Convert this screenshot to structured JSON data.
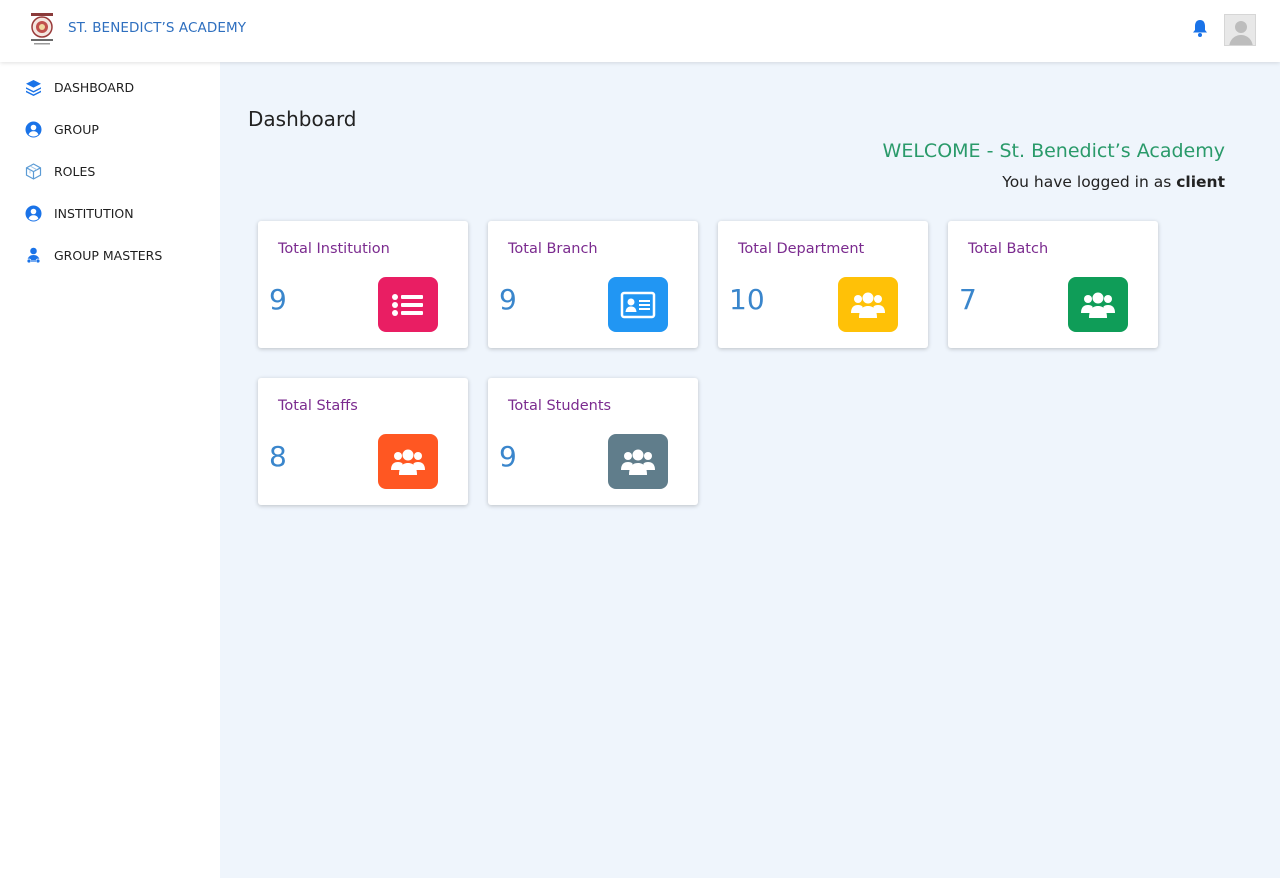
{
  "header": {
    "brand": "ST. BENEDICT’S ACADEMY",
    "logo_icon": "school-crest-icon",
    "notification_icon": "bell-icon",
    "avatar_icon": "user-avatar-icon"
  },
  "sidebar": {
    "items": [
      {
        "label": "DASHBOARD",
        "icon": "layers-icon"
      },
      {
        "label": "GROUP",
        "icon": "user-circle-icon"
      },
      {
        "label": "ROLES",
        "icon": "cube-icon"
      },
      {
        "label": "INSTITUTION",
        "icon": "user-circle-icon"
      },
      {
        "label": "GROUP MASTERS",
        "icon": "user-network-icon"
      }
    ]
  },
  "main": {
    "title": "Dashboard",
    "welcome": "WELCOME - St. Benedict’s Academy",
    "logged_prefix": "You have logged in as ",
    "logged_role": "client"
  },
  "cards": [
    {
      "title": "Total Institution",
      "count": "9",
      "icon": "list-icon",
      "color": "#e91e63"
    },
    {
      "title": "Total Branch",
      "count": "9",
      "icon": "id-card-icon",
      "color": "#2196f3"
    },
    {
      "title": "Total Department",
      "count": "10",
      "icon": "users-icon",
      "color": "#ffc107"
    },
    {
      "title": "Total Batch",
      "count": "7",
      "icon": "users-icon",
      "color": "#0f9d58"
    },
    {
      "title": "Total Staffs",
      "count": "8",
      "icon": "users-icon",
      "color": "#ff5722"
    },
    {
      "title": "Total Students",
      "count": "9",
      "icon": "users-icon",
      "color": "#607d8b"
    }
  ],
  "colors": {
    "brand": "#2e6fbf",
    "welcome": "#2a9a6a",
    "card_title": "#7b2b8f",
    "count": "#3a86cc",
    "background": "#eff5fc",
    "accent": "#1a73e8"
  }
}
